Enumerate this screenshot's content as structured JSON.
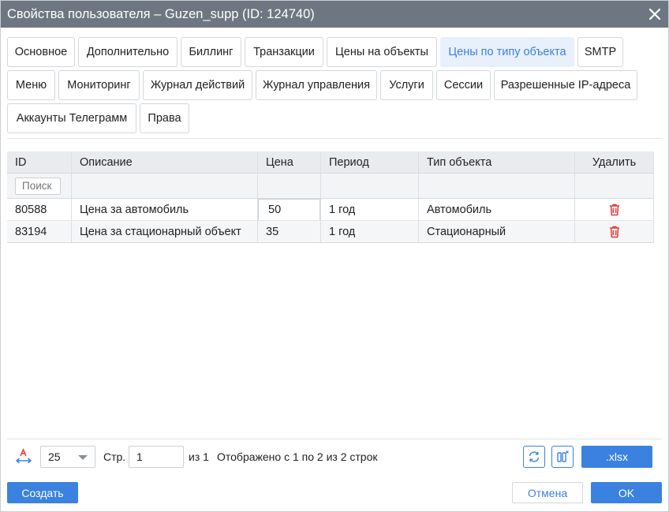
{
  "window": {
    "title": "Свойства пользователя – Guzen_supp (ID: 124740)"
  },
  "tabs": [
    {
      "label": "Основное"
    },
    {
      "label": "Дополнительно"
    },
    {
      "label": "Биллинг"
    },
    {
      "label": "Транзакции"
    },
    {
      "label": "Цены на объекты"
    },
    {
      "label": "Цены по типу объекта",
      "active": true
    },
    {
      "label": "SMTP"
    },
    {
      "label": "Меню"
    },
    {
      "label": "Мониторинг"
    },
    {
      "label": "Журнал действий"
    },
    {
      "label": "Журнал управления"
    },
    {
      "label": "Услуги"
    },
    {
      "label": "Сессии"
    },
    {
      "label": "Разрешенные IP-адреса"
    },
    {
      "label": "Аккаунты Телеграмм"
    },
    {
      "label": "Права"
    }
  ],
  "grid": {
    "columns": [
      "ID",
      "Описание",
      "Цена",
      "Период",
      "Тип объекта",
      "Удалить"
    ],
    "search_placeholder": "Поиск",
    "rows": [
      {
        "id": "80588",
        "description": "Цена за автомобиль",
        "price": "50",
        "period": "1 год",
        "object_type": "Автомобиль"
      },
      {
        "id": "83194",
        "description": "Цена за стационарный объект",
        "price": "35",
        "period": "1 год",
        "object_type": "Стационарный"
      }
    ]
  },
  "pager": {
    "page_size": "25",
    "page_label": "Стр.",
    "page": "1",
    "of_label": "из 1",
    "summary": "Отображено с 1 по 2 из 2 строк",
    "export_label": ".xlsx"
  },
  "actions": {
    "create": "Создать",
    "cancel": "Отмена",
    "ok": "OK"
  },
  "colors": {
    "accent": "#3b82e0",
    "titlebar": "#6e7781",
    "danger": "#e53935",
    "active_tab_bg": "#e8f0fb"
  }
}
